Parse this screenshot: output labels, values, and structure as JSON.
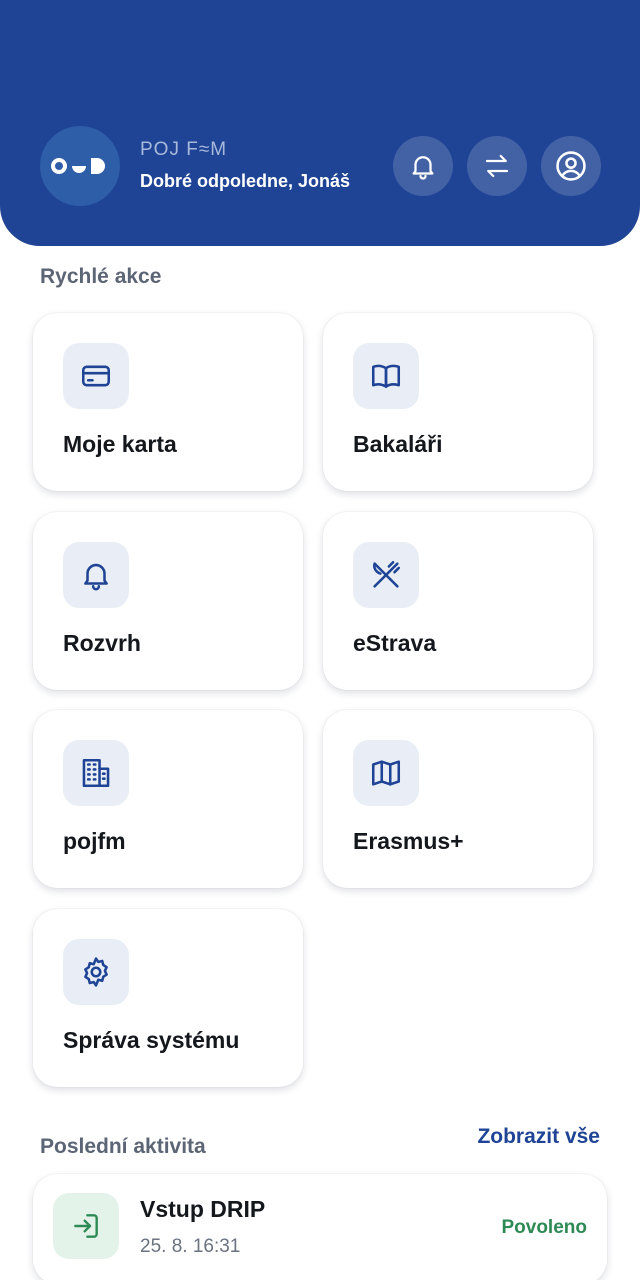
{
  "header": {
    "brand": "POJ F≈M",
    "greeting": "Dobré odpoledne, Jonáš",
    "buttons": [
      {
        "icon": "bell-icon",
        "name": "notifications-button"
      },
      {
        "icon": "switch-arrows-icon",
        "name": "switch-button"
      },
      {
        "icon": "user-circle-icon",
        "name": "profile-button"
      }
    ],
    "color": "#1f4496"
  },
  "quick_actions": {
    "title": "Rychlé akce",
    "items": [
      {
        "label": "Moje karta",
        "icon": "credit-card-icon"
      },
      {
        "label": "Bakaláři",
        "icon": "open-book-icon"
      },
      {
        "label": "Rozvrh",
        "icon": "bell-icon"
      },
      {
        "label": "eStrava",
        "icon": "fork-knife-icon"
      },
      {
        "label": "pojfm",
        "icon": "building-icon"
      },
      {
        "label": "Erasmus+",
        "icon": "map-icon"
      },
      {
        "label": "Správa systému",
        "icon": "gear-icon"
      }
    ]
  },
  "recent_activity": {
    "title": "Poslední aktivita",
    "view_all": "Zobrazit vše",
    "items": [
      {
        "title": "Vstup DRIP",
        "time": "25. 8. 16:31",
        "status": "Povoleno",
        "icon": "sign-in-icon",
        "status_color": "#2e8a55"
      }
    ]
  }
}
